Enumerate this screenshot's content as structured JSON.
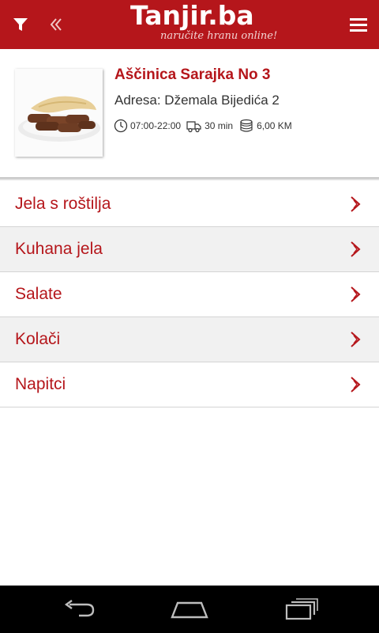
{
  "app": {
    "logo_title": "Tanjir.ba",
    "logo_tagline": "naručite hranu online!",
    "accent_color": "#b5161b"
  },
  "icons": {
    "filter": "filter-icon",
    "back": "double-chevron-left-icon",
    "menu": "hamburger-menu-icon",
    "clock": "clock-icon",
    "delivery": "delivery-truck-icon",
    "money": "coins-icon",
    "row_chevron": "chevron-right-icon",
    "nav_back": "back-arrow-icon",
    "nav_home": "home-icon",
    "nav_recents": "recent-apps-icon"
  },
  "restaurant": {
    "name": "Aščinica Sarajka No 3",
    "address": "Adresa: Džemala Bijedića 2",
    "hours": "07:00-22:00",
    "delivery_time": "30 min",
    "min_order": "6,00 KM"
  },
  "categories": [
    {
      "label": "Jela s roštilja"
    },
    {
      "label": "Kuhana jela"
    },
    {
      "label": "Salate"
    },
    {
      "label": "Kolači"
    },
    {
      "label": "Napitci"
    }
  ]
}
